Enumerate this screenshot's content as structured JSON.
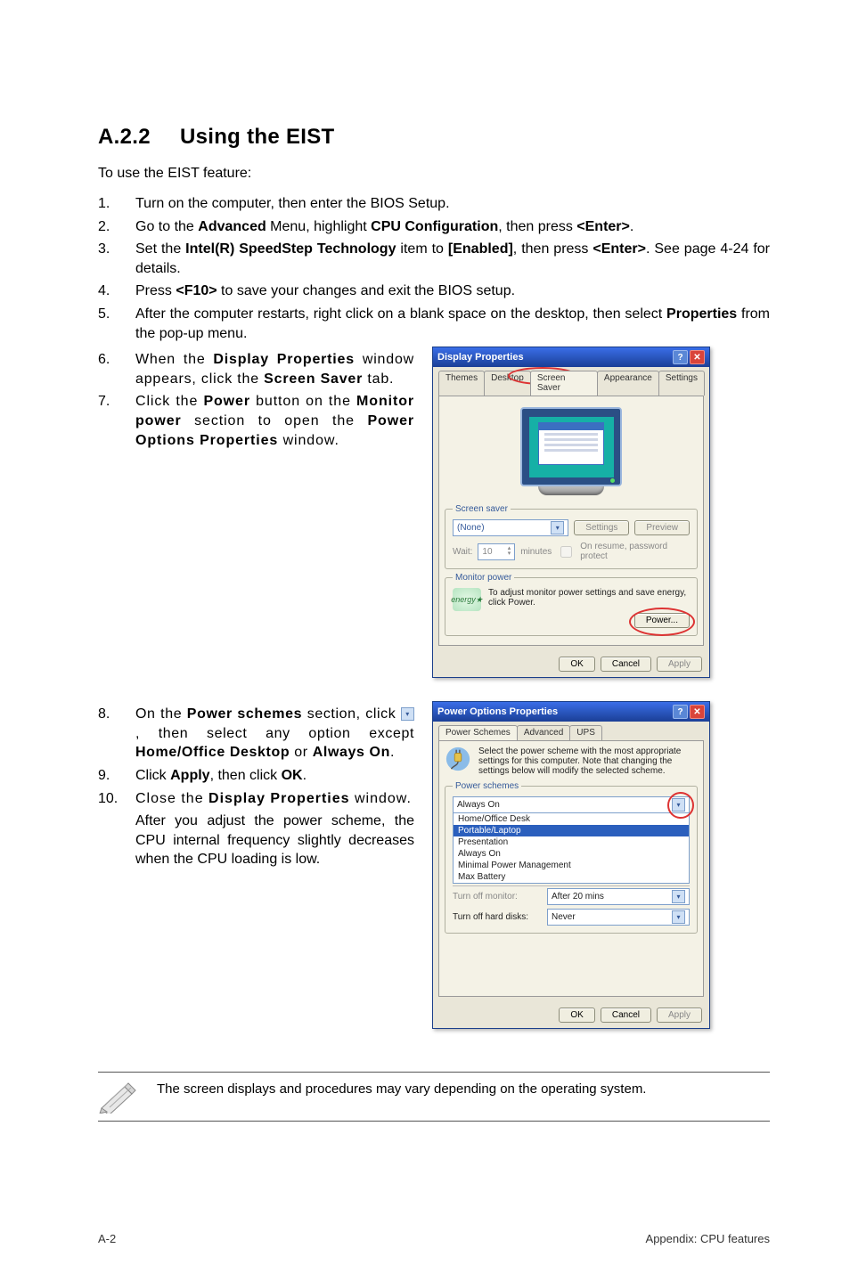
{
  "header": {
    "number": "A.2.2",
    "title": "Using the EIST"
  },
  "intro": "To use the EIST feature:",
  "steps": [
    {
      "n": "1.",
      "text_a": "Turn on the computer, then enter the BIOS Setup."
    },
    {
      "n": "2.",
      "text_a": "Go to the ",
      "b1": "Advanced",
      "text_b": " Menu, highlight ",
      "b2": "CPU Configuration",
      "text_c": ", then press ",
      "b3": "<Enter>",
      "text_d": "."
    },
    {
      "n": "3.",
      "text_a": "Set the ",
      "b1": "Intel(R) SpeedStep Technology",
      "text_b": " item to ",
      "b2": "[Enabled]",
      "text_c": ", then press ",
      "b3": "<Enter>",
      "text_d": ". See page 4-24 for details."
    },
    {
      "n": "4.",
      "text_a": "Press ",
      "b1": "<F10>",
      "text_b": " to save your changes and exit the BIOS setup."
    },
    {
      "n": "5.",
      "text_a": "After the computer restarts, right click on a blank space on the desktop, then select ",
      "b1": "Properties",
      "text_b": " from the pop-up menu."
    },
    {
      "n": "6.",
      "text_a": "When the ",
      "b1": "Display Properties",
      "text_b": " window appears, click the ",
      "b2": "Screen Saver",
      "text_c": " tab."
    },
    {
      "n": "7.",
      "text_a": "Click the ",
      "b1": "Power",
      "text_b": " button on the ",
      "b2": "Monitor power",
      "text_c": " section to open the ",
      "b3": "Power Options Properties",
      "text_d": " window."
    },
    {
      "n": "8.",
      "text_a": "On the ",
      "b1": "Power schemes",
      "text_b": " section, click  ",
      "icon": "dropdown-icon",
      "text_c": ", then select any option except ",
      "b2": "Home/Office Desktop",
      "text_d": " or ",
      "b3": "Always On",
      "text_e": "."
    },
    {
      "n": "9.",
      "text_a": "Click ",
      "b1": "Apply",
      "text_b": ", then click ",
      "b2": "OK",
      "text_c": "."
    },
    {
      "n": "10.",
      "text_a": "Close the ",
      "b1": "Display Properties",
      "text_b": " window."
    }
  ],
  "after_text": "After you adjust the power scheme, the CPU internal frequency slightly decreases when the CPU loading is low.",
  "note": "The screen displays and procedures may vary depending on the operating system.",
  "footer_left": "A-2",
  "footer_right": "Appendix: CPU features",
  "display_dialog": {
    "title": "Display Properties",
    "tabs": [
      "Themes",
      "Desktop",
      "Screen Saver",
      "Appearance",
      "Settings"
    ],
    "fieldset_screensaver": "Screen saver",
    "ss_selected": "(None)",
    "btn_settings": "Settings",
    "btn_preview": "Preview",
    "wait_label": "Wait:",
    "wait_value": "10",
    "wait_unit": "minutes",
    "resume_chk": "On resume, password protect",
    "fieldset_monitor": "Monitor power",
    "monitor_desc": "To adjust monitor power settings and save energy, click Power.",
    "btn_power": "Power...",
    "btn_ok": "OK",
    "btn_cancel": "Cancel",
    "btn_apply": "Apply"
  },
  "power_dialog": {
    "title": "Power Options Properties",
    "tabs": [
      "Power Schemes",
      "Advanced",
      "UPS"
    ],
    "desc": "Select the power scheme with the most appropriate settings for this computer. Note that changing the settings below will modify the selected scheme.",
    "fieldset_schemes": "Power schemes",
    "scheme_selected": "Always On",
    "scheme_options": [
      "Home/Office Desk",
      "Portable/Laptop",
      "Presentation",
      "Always On",
      "Minimal Power Management",
      "Max Battery"
    ],
    "turn_off_mon_label": "Turn off monitor:",
    "turn_off_mon_value": "After 20 mins",
    "turn_off_hd_label": "Turn off hard disks:",
    "turn_off_hd_value": "Never",
    "btn_ok": "OK",
    "btn_cancel": "Cancel",
    "btn_apply": "Apply"
  }
}
